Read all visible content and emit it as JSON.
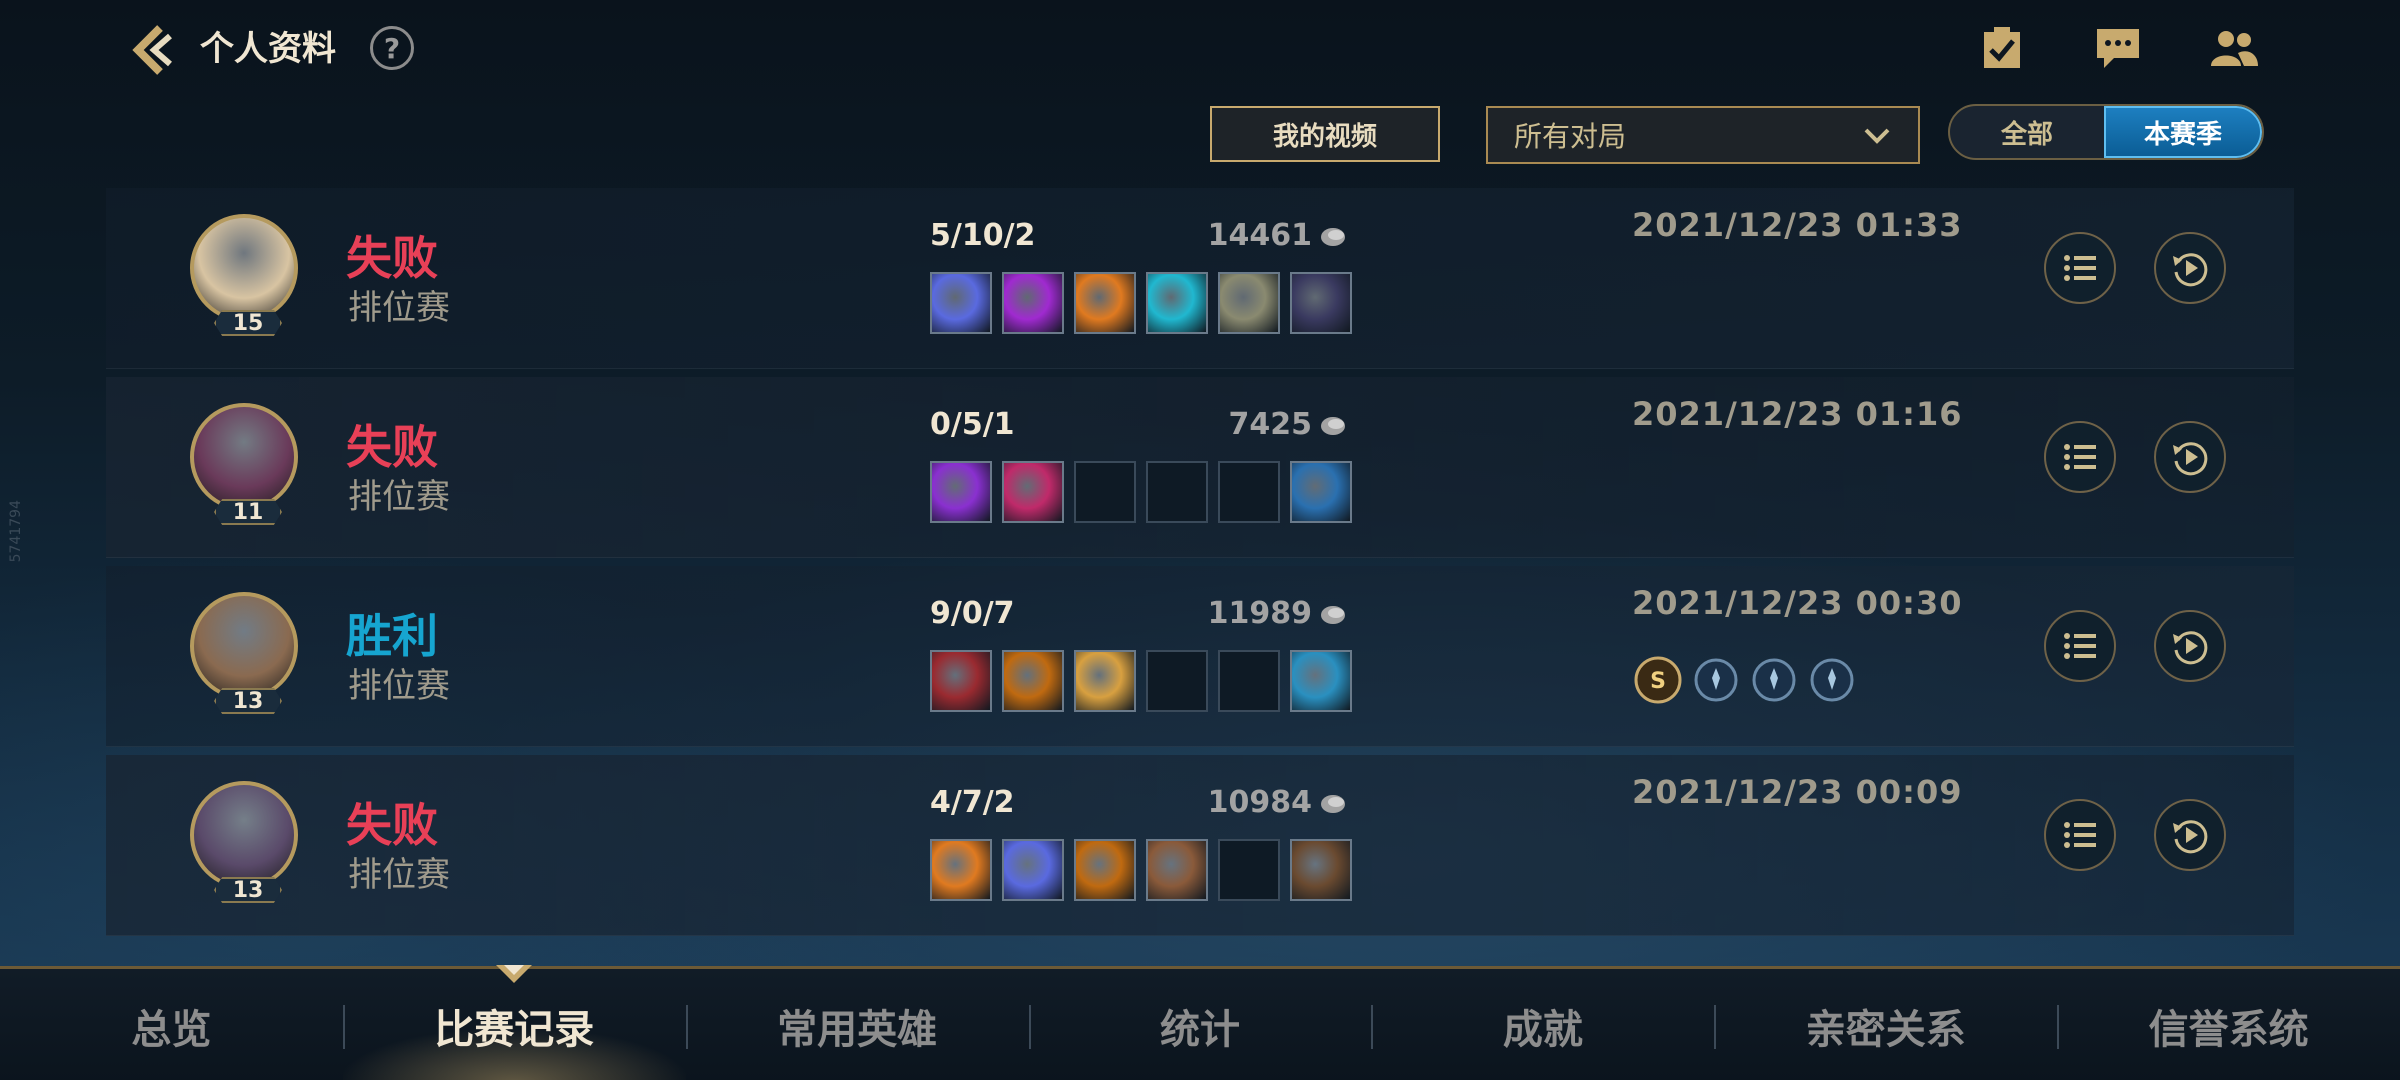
{
  "header": {
    "title": "个人资料",
    "help_label": "?"
  },
  "filters": {
    "video_label": "我的视频",
    "match_filter": "所有对局",
    "toggle": [
      "全部",
      "本赛季"
    ],
    "toggle_active": "本赛季"
  },
  "matches": [
    {
      "result": "失败",
      "outcome": "loss",
      "queue": "排位赛",
      "level": "15",
      "kda": "5/10/2",
      "gold": "14461",
      "date": "2021/12/23 01:33",
      "portrait_color": "#d8c4a2",
      "items": [
        "#5a6ae0",
        "#a02ad0",
        "#e07a20",
        "#20b8d0",
        "#8a8a70",
        "#3a3a60"
      ],
      "badges": []
    },
    {
      "result": "失败",
      "outcome": "loss",
      "queue": "排位赛",
      "level": "11",
      "kda": "0/5/1",
      "gold": "7425",
      "date": "2021/12/23 01:16",
      "portrait_color": "#6a3a5a",
      "items": [
        "#8a30d0",
        "#c02a6a",
        "",
        "",
        "",
        "#2a70b0"
      ],
      "badges": []
    },
    {
      "result": "胜利",
      "outcome": "win",
      "queue": "排位赛",
      "level": "13",
      "kda": "9/0/7",
      "gold": "11989",
      "date": "2021/12/23 00:30",
      "portrait_color": "#8a6a50",
      "items": [
        "#9a2a30",
        "#c06a10",
        "#d8a040",
        "",
        "",
        "#2a90c0"
      ],
      "badges": [
        "S",
        "a",
        "b",
        "c"
      ]
    },
    {
      "result": "失败",
      "outcome": "loss",
      "queue": "排位赛",
      "level": "13",
      "kda": "4/7/2",
      "gold": "10984",
      "date": "2021/12/23 00:09",
      "portrait_color": "#5a4a6a",
      "items": [
        "#e07a20",
        "#5a6ae0",
        "#c06a10",
        "#8a5a3a",
        "",
        "#6a4a30"
      ],
      "badges": []
    }
  ],
  "tabs": [
    "总览",
    "比赛记录",
    "常用英雄",
    "统计",
    "成就",
    "亲密关系",
    "信誉系统"
  ],
  "active_tab": "比赛记录",
  "side_id": "5741794"
}
